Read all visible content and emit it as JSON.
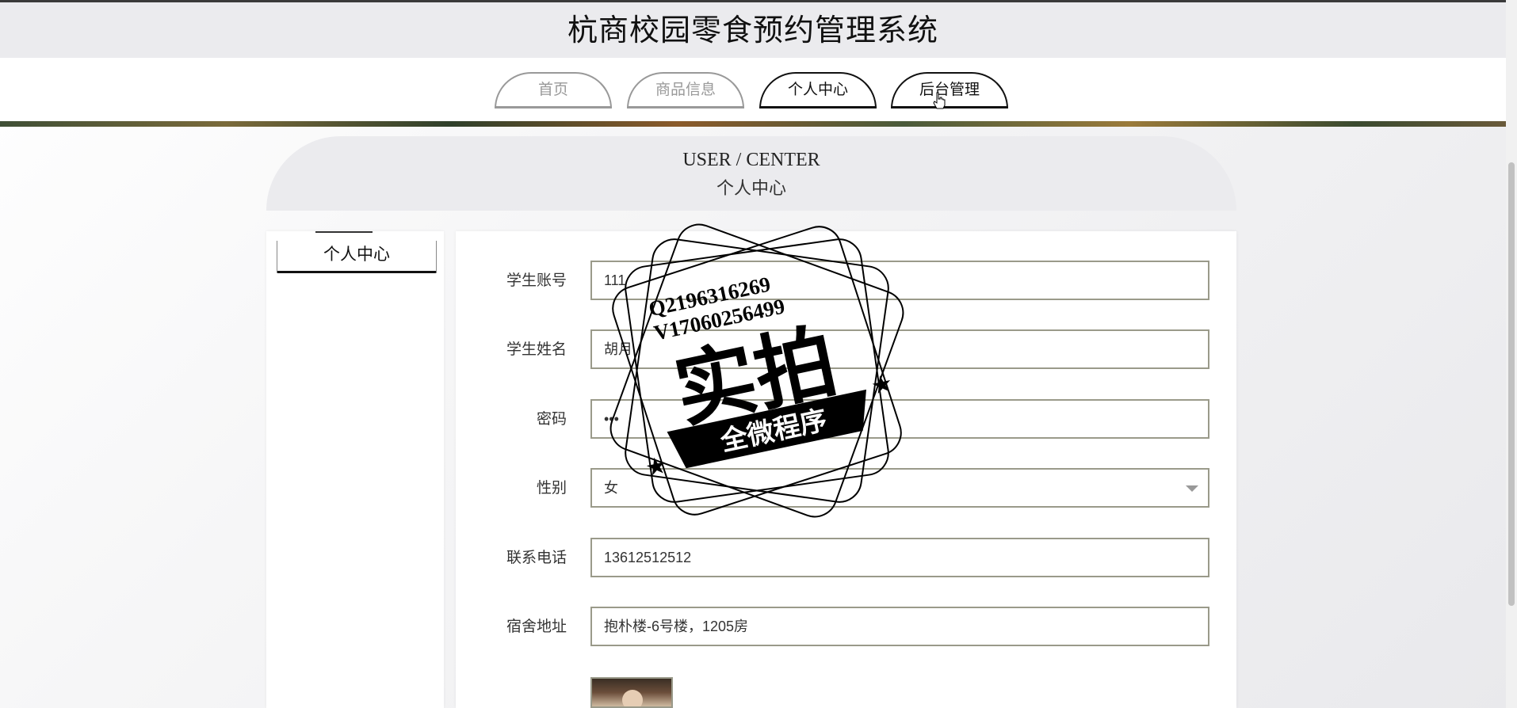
{
  "app": {
    "title": "杭商校园零食预约管理系统"
  },
  "nav": [
    {
      "label": "首页",
      "active": false
    },
    {
      "label": "商品信息",
      "active": false
    },
    {
      "label": "个人中心",
      "active": true
    },
    {
      "label": "后台管理",
      "active": true
    }
  ],
  "user_center": {
    "title_en": "USER / CENTER",
    "title_cn": "个人中心"
  },
  "sidebar": {
    "items": [
      {
        "label": "个人中心"
      }
    ]
  },
  "form": {
    "student_account": {
      "label": "学生账号",
      "value": "111"
    },
    "student_name": {
      "label": "学生姓名",
      "value": "胡月"
    },
    "password": {
      "label": "密码",
      "value": "•••"
    },
    "gender": {
      "label": "性别",
      "value": "女"
    },
    "phone": {
      "label": "联系电话",
      "value": "13612512512"
    },
    "address": {
      "label": "宿舍地址",
      "value": "抱朴楼-6号楼，1205房"
    }
  },
  "watermark": {
    "contact_q": "Q2196316269",
    "contact_v": "V17060256499",
    "main": "实拍",
    "ribbon": "全微程序"
  },
  "colors": {
    "border": "#9a9a8a",
    "header_bg": "#ebebee",
    "active": "#111111"
  }
}
